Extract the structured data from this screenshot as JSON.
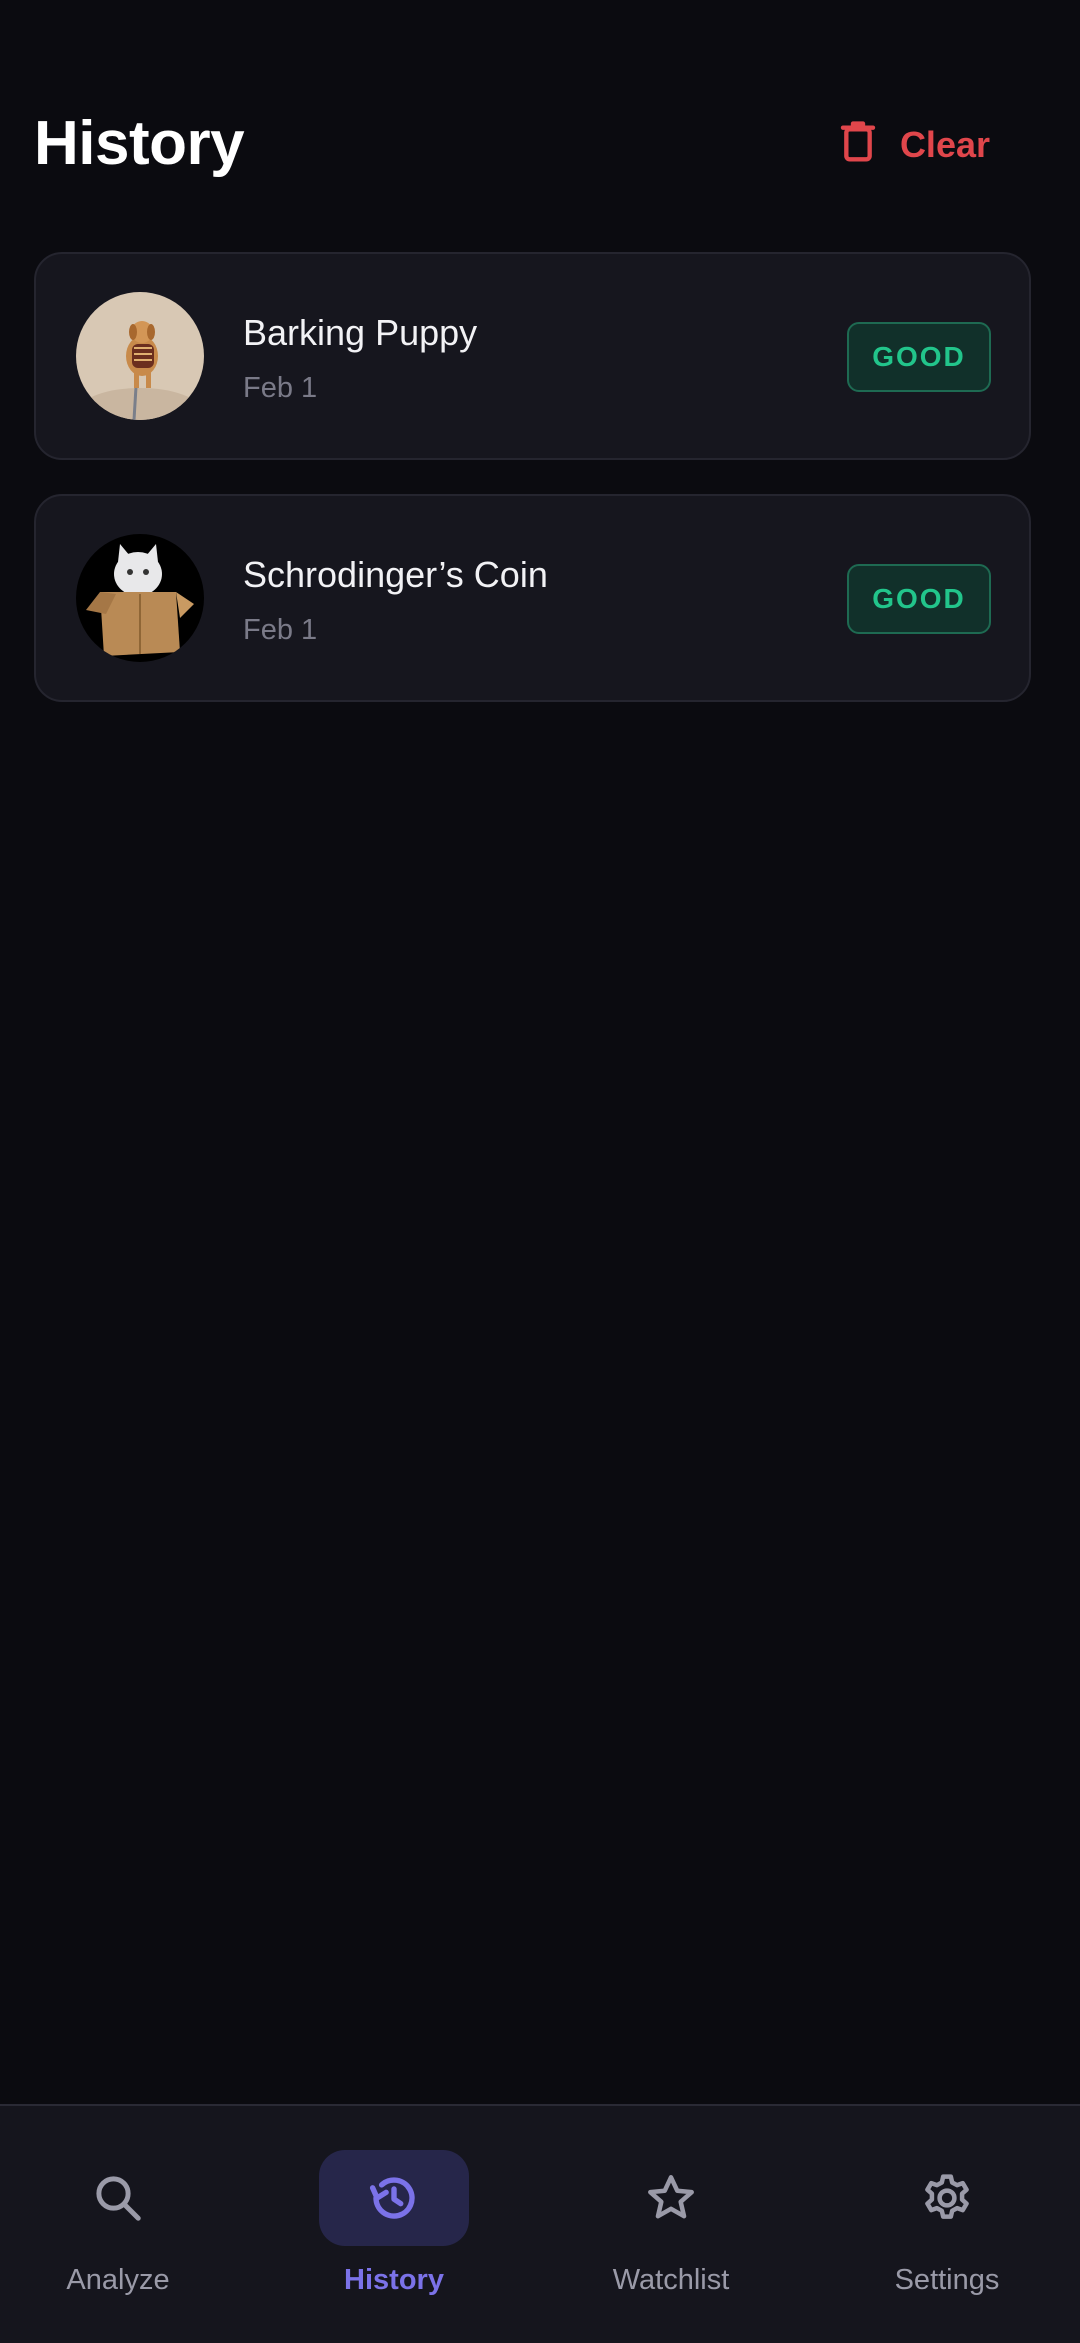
{
  "header": {
    "title": "History",
    "clear_label": "Clear",
    "clear_icon": "trash-icon"
  },
  "history": [
    {
      "title": "Barking Puppy",
      "date": "Feb 1",
      "status": "GOOD",
      "avatar": "puppy-image"
    },
    {
      "title": "Schrodinger’s Coin",
      "date": "Feb 1",
      "status": "GOOD",
      "avatar": "cat-in-box-image"
    }
  ],
  "nav": {
    "items": [
      {
        "label": "Analyze",
        "icon": "search-icon"
      },
      {
        "label": "History",
        "icon": "history-icon",
        "active": true
      },
      {
        "label": "Watchlist",
        "icon": "star-icon"
      },
      {
        "label": "Settings",
        "icon": "gear-icon"
      }
    ]
  },
  "colors": {
    "background": "#0b0b10",
    "card": "#16161e",
    "danger": "#e0464b",
    "good": "#22c58b",
    "accent": "#7b72e8"
  }
}
